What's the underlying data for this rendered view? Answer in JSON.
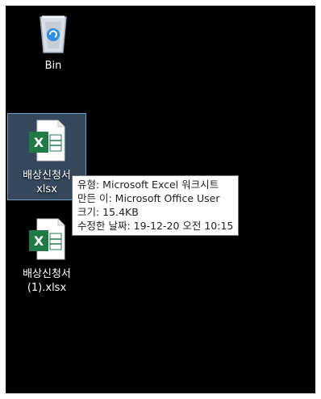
{
  "desktop": {
    "icons": [
      {
        "label": "Bin",
        "icon": "recycle-bin-icon"
      },
      {
        "label_line1": "배상신청서",
        "label_line2": "xlsx",
        "icon": "excel-file-icon",
        "selected": true
      },
      {
        "label_line1": "배상신청서",
        "label_line2": "(1).xlsx",
        "icon": "excel-file-icon",
        "selected": false
      }
    ]
  },
  "tooltip": {
    "type": "유형: Microsoft Excel 워크시트",
    "author": "만든 이: Microsoft Office User",
    "size": "크기: 15.4KB",
    "modified": "수정한 날짜: 19-12-20 오전 10:15"
  },
  "colors": {
    "desktop_bg": "#000000",
    "excel_green": "#1f7a45",
    "selection": "#4d6f95"
  }
}
